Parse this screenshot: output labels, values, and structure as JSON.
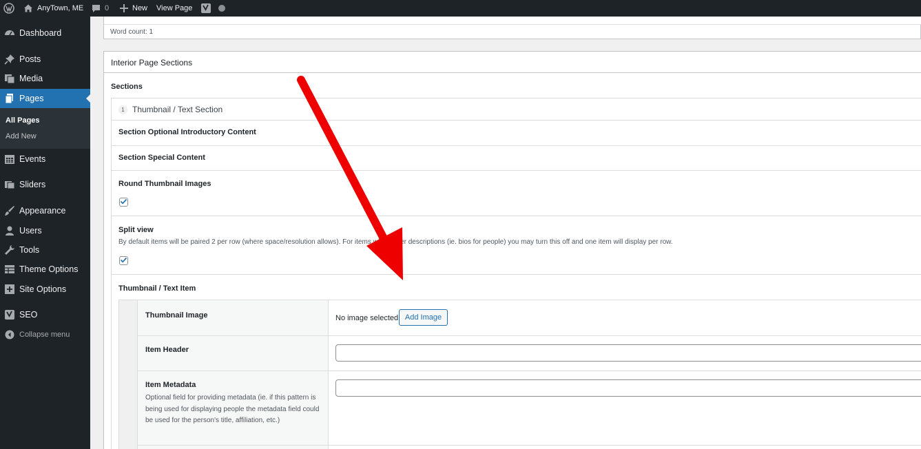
{
  "admin_bar": {
    "site_name": "AnyTown, ME",
    "comments_count": "0",
    "new_label": "New",
    "view_page_label": "View Page"
  },
  "sidebar": {
    "items": [
      {
        "label": "Dashboard",
        "icon": "dashboard-icon"
      },
      {
        "label": "Posts",
        "icon": "pushpin-icon"
      },
      {
        "label": "Media",
        "icon": "media-icon"
      },
      {
        "label": "Pages",
        "icon": "pages-icon",
        "active": true
      },
      {
        "label": "Events",
        "icon": "calendar-icon"
      },
      {
        "label": "Sliders",
        "icon": "slides-icon"
      },
      {
        "label": "Appearance",
        "icon": "paintbrush-icon"
      },
      {
        "label": "Users",
        "icon": "users-icon"
      },
      {
        "label": "Tools",
        "icon": "wrench-icon"
      },
      {
        "label": "Theme Options",
        "icon": "grid-icon"
      },
      {
        "label": "Site Options",
        "icon": "plus-box-icon"
      },
      {
        "label": "SEO",
        "icon": "yoast-icon"
      }
    ],
    "submenu": [
      "All Pages",
      "Add New"
    ],
    "collapse_label": "Collapse menu"
  },
  "editor": {
    "word_count": "Word count: 1"
  },
  "metabox": {
    "title": "Interior Page Sections",
    "sections_label": "Sections",
    "section": {
      "number": "1",
      "title": "Thumbnail / Text Section",
      "fields": {
        "intro_label": "Section Optional Introductory Content",
        "special_label": "Section Special Content",
        "round_thumb_label": "Round Thumbnail Images",
        "round_thumb_checked": true,
        "split_view_label": "Split view",
        "split_view_desc": "By default items will be paired 2 per row (where space/resolution allows). For items with longer descriptions (ie. bios for people) you may turn this off and one item will display per row.",
        "split_view_checked": true,
        "item_group_label": "Thumbnail / Text Item"
      },
      "item": {
        "thumbnail_label": "Thumbnail Image",
        "no_image_text": "No image selected",
        "add_image_label": "Add Image",
        "header_label": "Item Header",
        "header_value": "",
        "metadata_label": "Item Metadata",
        "metadata_desc": "Optional field for providing metadata (ie. if this pattern is being used for displaying people the metadata field could be used for the person's title, affiliation, etc.)",
        "metadata_value": ""
      }
    }
  },
  "colors": {
    "admin_bg": "#1d2327",
    "accent": "#2271b1",
    "annotation_arrow": "#ee0000"
  }
}
